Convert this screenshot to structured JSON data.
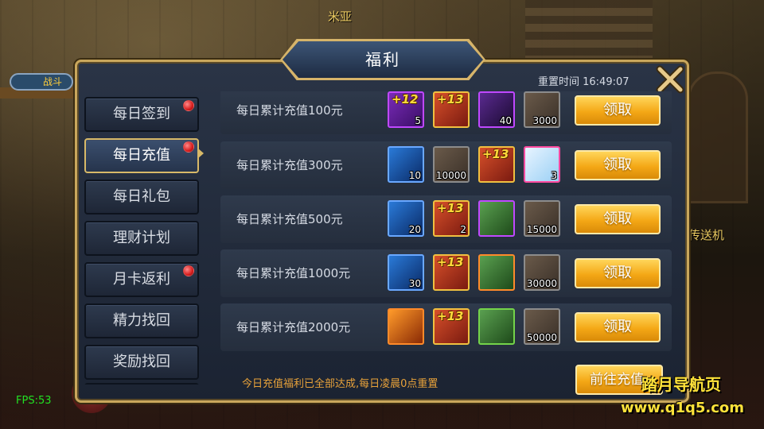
{
  "background": {
    "top_label": "米亚",
    "right_label": "传送机",
    "left_badge": "战斗"
  },
  "window": {
    "title": "福利",
    "reset_time": "重置时间 16:49:07"
  },
  "sidebar": {
    "items": [
      {
        "label": "每日签到",
        "badge": true,
        "active": false
      },
      {
        "label": "每日充值",
        "badge": true,
        "active": true
      },
      {
        "label": "每日礼包",
        "badge": false,
        "active": false
      },
      {
        "label": "理财计划",
        "badge": false,
        "active": false
      },
      {
        "label": "月卡返利",
        "badge": true,
        "active": false
      },
      {
        "label": "精力找回",
        "badge": false,
        "active": false
      },
      {
        "label": "奖励找回",
        "badge": false,
        "active": false
      }
    ]
  },
  "rewards": [
    {
      "label": "每日累计充值100元",
      "button": "领取",
      "items": [
        {
          "icon": "purple-gem-icon",
          "plus": "+12",
          "qty": "5",
          "border": "purple"
        },
        {
          "icon": "gold-gem-icon",
          "plus": "+13",
          "qty": "",
          "border": "gold"
        },
        {
          "icon": "purple-book-icon",
          "plus": "",
          "qty": "40",
          "border": "purple"
        },
        {
          "icon": "scroll-icon",
          "plus": "",
          "qty": "3000",
          "border": "gray"
        }
      ]
    },
    {
      "label": "每日累计充值300元",
      "button": "领取",
      "items": [
        {
          "icon": "hammer-icon",
          "plus": "",
          "qty": "10",
          "border": "blue"
        },
        {
          "icon": "scroll-icon",
          "plus": "",
          "qty": "10000",
          "border": "gray"
        },
        {
          "icon": "gold-gem-icon",
          "plus": "+13",
          "qty": "",
          "border": "gold"
        },
        {
          "icon": "ice-crystal-icon",
          "plus": "",
          "qty": "3",
          "border": "pink"
        }
      ]
    },
    {
      "label": "每日累计充值500元",
      "button": "领取",
      "items": [
        {
          "icon": "hammer-icon",
          "plus": "",
          "qty": "20",
          "border": "blue"
        },
        {
          "icon": "gold-gem-icon",
          "plus": "+13",
          "qty": "2",
          "border": "gold"
        },
        {
          "icon": "green-scroll-icon",
          "plus": "",
          "qty": "",
          "border": "purple"
        },
        {
          "icon": "scroll-icon",
          "plus": "",
          "qty": "15000",
          "border": "gray"
        }
      ]
    },
    {
      "label": "每日累计充值1000元",
      "button": "领取",
      "items": [
        {
          "icon": "hammer-icon",
          "plus": "",
          "qty": "30",
          "border": "blue"
        },
        {
          "icon": "gold-gem-icon",
          "plus": "+13",
          "qty": "",
          "border": "gold"
        },
        {
          "icon": "green-scroll-icon",
          "plus": "",
          "qty": "",
          "border": "orange"
        },
        {
          "icon": "scroll-icon",
          "plus": "",
          "qty": "30000",
          "border": "gray"
        }
      ]
    },
    {
      "label": "每日累计充值2000元",
      "button": "领取",
      "items": [
        {
          "icon": "orange-hammer-icon",
          "plus": "",
          "qty": "",
          "border": "orange"
        },
        {
          "icon": "gold-gem-icon",
          "plus": "+13",
          "qty": "",
          "border": "gold"
        },
        {
          "icon": "green-scroll-icon",
          "plus": "",
          "qty": "",
          "border": "green"
        },
        {
          "icon": "scroll-icon",
          "plus": "",
          "qty": "50000",
          "border": "gray"
        }
      ]
    }
  ],
  "footer": {
    "note": "今日充值福利已全部达成,每日凌晨0点重置",
    "goto_button": "前往充值"
  },
  "overlay": {
    "fps": "FPS:53",
    "watermark_name": "踏月导航页",
    "watermark_url": "www.q1q5.com"
  },
  "colors": {
    "accent_gold": "#d6b46a",
    "button_orange": "#f4a816",
    "note_orange": "#e8a23a",
    "fps_green": "#22e022"
  }
}
